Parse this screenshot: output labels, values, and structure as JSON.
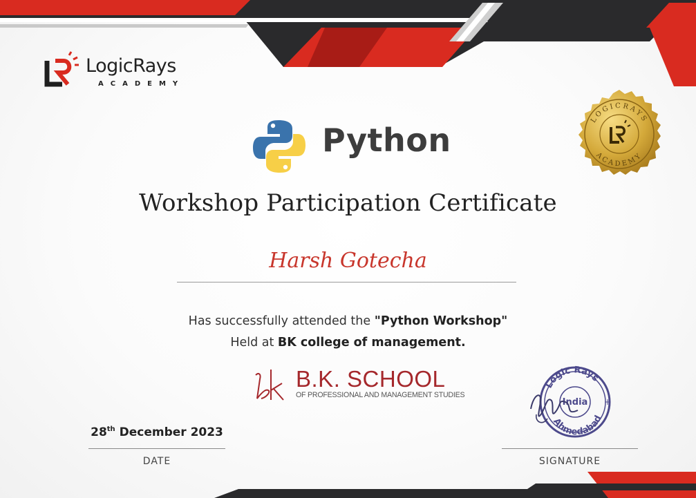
{
  "brand": {
    "name": "LogicRays",
    "sub": "ACADEMY",
    "seal_text_top": "LOGICRAYS",
    "seal_text_bottom": "ACADEMY"
  },
  "course": {
    "name": "Python"
  },
  "certificate": {
    "title": "Workshop Participation Certificate",
    "recipient": "Harsh Gotecha",
    "line1_prefix": "Has successfully attended the ",
    "line1_event": "\"Python Workshop\"",
    "line2_prefix": "Held at ",
    "line2_venue": "BK college of management."
  },
  "institution": {
    "name": "B.K. SCHOOL",
    "sub": "OF PROFESSIONAL AND MANAGEMENT STUDIES"
  },
  "date": {
    "day": "28",
    "suffix": "th",
    "rest": " December 2023",
    "label": "DATE"
  },
  "signature": {
    "label": "SIGNATURE",
    "stamp_top": "Logic Rays",
    "stamp_middle": "India",
    "stamp_bottom": "Ahmedabad"
  },
  "colors": {
    "accent_red": "#d92b20",
    "dark": "#2a2a2c",
    "gold": "#d4a93a",
    "name_red": "#c8362c",
    "bk_red": "#a5282c",
    "stamp_purple": "#4d4a8c"
  }
}
